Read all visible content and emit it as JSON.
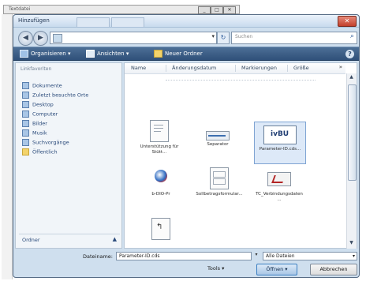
{
  "background_window": {
    "title": "Textdatei"
  },
  "dialog": {
    "title": "Hinzufügen",
    "title_tabs": [
      "",
      ""
    ],
    "close_glyph": "✕"
  },
  "address_bar": {
    "back_glyph": "◀",
    "forward_glyph": "▶",
    "path": "",
    "dropdown_glyph": "▾",
    "refresh_glyph": "↻",
    "search_placeholder": "Suchen",
    "search_icon": "search-icon"
  },
  "toolbar": {
    "organize_label": "Organisieren ▾",
    "views_label": "Ansichten ▾",
    "new_folder_label": "Neuer Ordner",
    "help_glyph": "?"
  },
  "nav_pane": {
    "header": "Linkfavoriten",
    "items": [
      {
        "label": "Dokumente",
        "icon": "documents-icon"
      },
      {
        "label": "Zuletzt besuchte Orte",
        "icon": "recent-places-icon"
      },
      {
        "label": "Desktop",
        "icon": "desktop-icon"
      },
      {
        "label": "Computer",
        "icon": "computer-icon"
      },
      {
        "label": "Bilder",
        "icon": "pictures-icon"
      },
      {
        "label": "Musik",
        "icon": "music-icon"
      },
      {
        "label": "Suchvorgänge",
        "icon": "searches-icon"
      },
      {
        "label": "Öffentlich",
        "icon": "public-icon"
      }
    ],
    "folders_label": "Ordner",
    "folders_chevron": "▲"
  },
  "file_list": {
    "columns": [
      "Name",
      "Änderungsdatum",
      "Markierungen",
      "Größe"
    ],
    "more_glyph": "»",
    "items": [
      {
        "label": "Unterstützung für Stütt...",
        "icon": "document-icon",
        "selected": false
      },
      {
        "label": "Separator",
        "icon": "separator-icon",
        "selected": false
      },
      {
        "label": "Parameter-ID.cds...",
        "icon": "spreadsheet-icon",
        "selected": true,
        "badge": "ivBU"
      },
      {
        "label": "b-DIO-Pr",
        "icon": "globe-icon",
        "selected": false
      },
      {
        "label": "Sollbetragsformular...",
        "icon": "form-icon",
        "selected": false
      },
      {
        "label": "TC_Verbindungsdaten...",
        "icon": "mail-icon",
        "selected": false
      },
      {
        "label": "",
        "icon": "shortcut-icon",
        "selected": false
      }
    ]
  },
  "bottom": {
    "filename_label": "Dateiname:",
    "filename_value": "Parameter-ID.cds",
    "filter_value": "Alle Dateien",
    "tools_label": "Tools ▾",
    "open_label": "Öffnen ▾",
    "cancel_label": "Abbrechen"
  }
}
